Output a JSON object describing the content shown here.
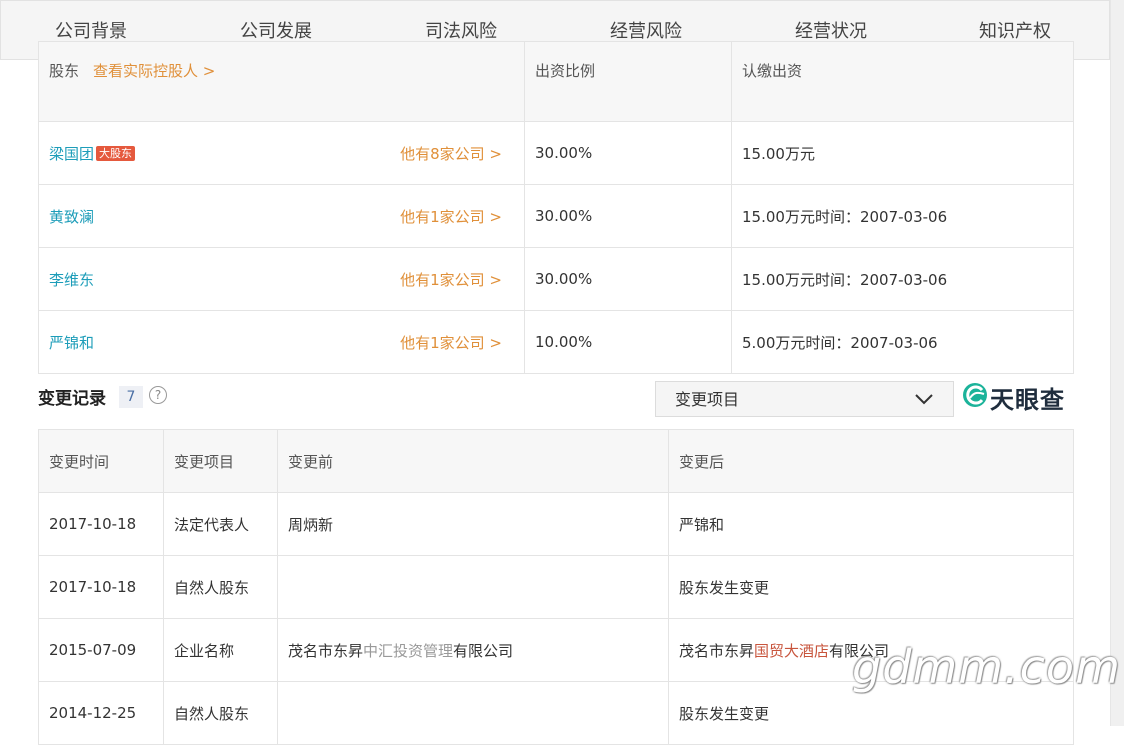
{
  "nav": {
    "tabs": [
      "公司背景",
      "公司发展",
      "司法风险",
      "经营风险",
      "经营状况",
      "知识产权"
    ]
  },
  "shareholders": {
    "headers": {
      "name": "股东",
      "link": "查看实际控股人 >",
      "ratio": "出资比例",
      "amount": "认缴出资"
    },
    "rows": [
      {
        "name": "梁国团",
        "badge": "大股东",
        "companies": "他有8家公司 >",
        "ratio": "30.00%",
        "amount": "15.00万元"
      },
      {
        "name": "黄致澜",
        "badge": "",
        "companies": "他有1家公司 >",
        "ratio": "30.00%",
        "amount": "15.00万元时间：2007-03-06"
      },
      {
        "name": "李维东",
        "badge": "",
        "companies": "他有1家公司 >",
        "ratio": "30.00%",
        "amount": "15.00万元时间：2007-03-06"
      },
      {
        "name": "严锦和",
        "badge": "",
        "companies": "他有1家公司 >",
        "ratio": "10.00%",
        "amount": "5.00万元时间：2007-03-06"
      }
    ]
  },
  "changes": {
    "title": "变更记录",
    "count": "7",
    "help": "?",
    "filter": "变更项目",
    "logo": "天眼查",
    "headers": {
      "time": "变更时间",
      "item": "变更项目",
      "before": "变更前",
      "after": "变更后"
    },
    "rows": [
      {
        "time": "2017-10-18",
        "item": "法定代表人",
        "before": "周炳新",
        "after": "严锦和"
      },
      {
        "time": "2017-10-18",
        "item": "自然人股东",
        "before": "",
        "after": "股东发生变更"
      },
      {
        "time": "2015-07-09",
        "item": "企业名称",
        "before_pre": "茂名市东昇",
        "before_hl": "中汇投资管理",
        "before_post": "有限公司",
        "after_pre": "茂名市东昇",
        "after_hl": "国贸大酒店",
        "after_post": "有限公司"
      },
      {
        "time": "2014-12-25",
        "item": "自然人股东",
        "before": "",
        "after": "股东发生变更"
      }
    ]
  },
  "watermark": "gdmm.com",
  "colors": {
    "link": "#1d9db9",
    "orange": "#e0903a",
    "percent": "#e24f4f",
    "highlight": "#c8553d",
    "badge": "#e5593d"
  }
}
